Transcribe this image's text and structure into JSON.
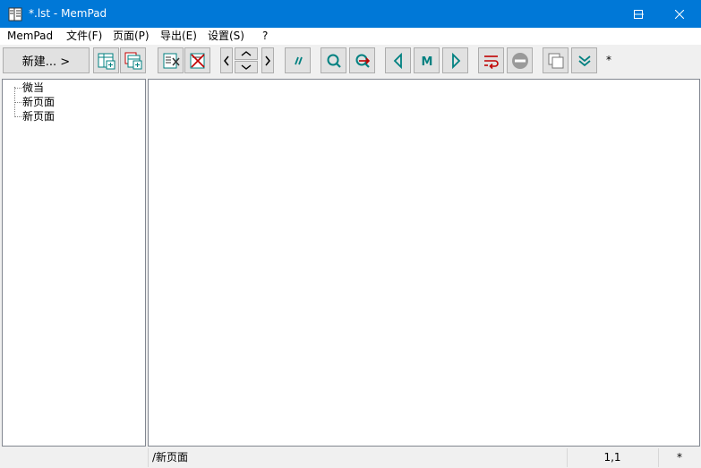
{
  "window": {
    "title": "*.lst - MemPad"
  },
  "menu": {
    "items": [
      "MemPad",
      "文件(F)",
      "页面(P)",
      "导出(E)",
      "设置(S)",
      "?"
    ]
  },
  "toolbar": {
    "new_label": "新建... >",
    "modified_indicator": "*"
  },
  "tree": {
    "items": [
      "微当",
      "新页面",
      "新页面"
    ]
  },
  "status": {
    "path": "/新页面",
    "position": "1,1",
    "modified": "*"
  },
  "colors": {
    "titlebar": "#0078d7",
    "icon_green": "#008080",
    "icon_red": "#c00000"
  }
}
